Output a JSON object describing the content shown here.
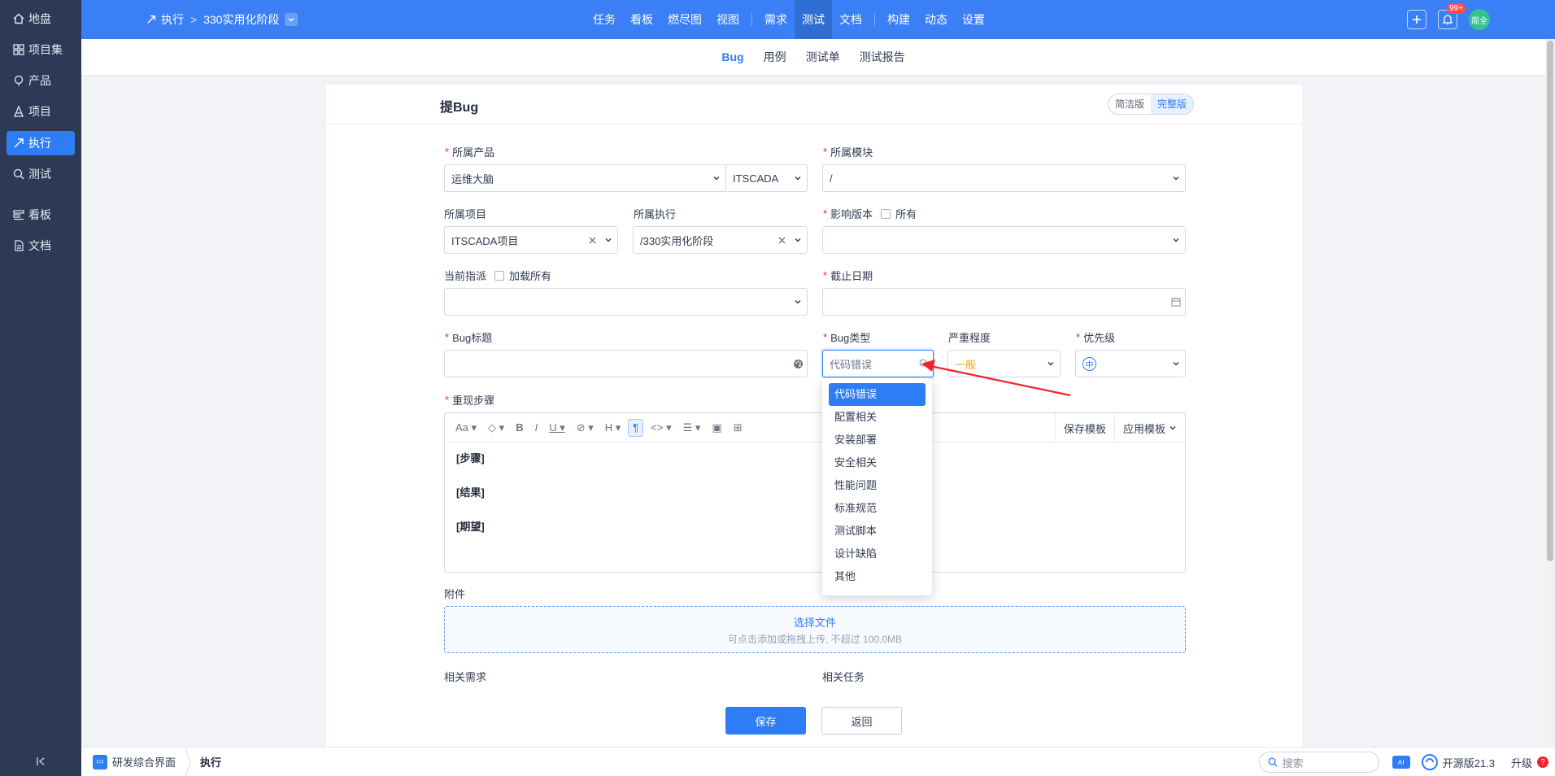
{
  "sidebar": {
    "items": [
      {
        "label": "地盘",
        "icon": "home-icon"
      },
      {
        "label": "项目集",
        "icon": "grid-icon"
      },
      {
        "label": "产品",
        "icon": "product-icon"
      },
      {
        "label": "项目",
        "icon": "project-icon"
      },
      {
        "label": "执行",
        "icon": "execute-icon",
        "active": true
      },
      {
        "label": "测试",
        "icon": "test-icon"
      },
      {
        "label": "看板",
        "icon": "kanban-icon"
      },
      {
        "label": "文档",
        "icon": "doc-icon"
      }
    ]
  },
  "header": {
    "breadcrumb_root": "执行",
    "breadcrumb_current": "330实用化阶段",
    "nav": [
      "任务",
      "看板",
      "燃尽图",
      "视图",
      "需求",
      "测试",
      "文档",
      "构建",
      "动态",
      "设置"
    ],
    "nav_active": "测试",
    "notification_badge": "99+",
    "avatar_text": "周全",
    "brand_color": "#3a7ff5"
  },
  "subnav": {
    "items": [
      "Bug",
      "用例",
      "测试单",
      "测试报告"
    ],
    "active": "Bug"
  },
  "form": {
    "title": "提Bug",
    "mode_simple": "简洁版",
    "mode_full": "完整版",
    "product_label": "所属产品",
    "product_value": "运维大脑",
    "branch_value": "ITSCADA",
    "module_label": "所属模块",
    "module_value": "/",
    "project_label": "所属项目",
    "project_value": "ITSCADA项目",
    "execution_label": "所属执行",
    "execution_value": "/330实用化阶段",
    "build_label": "影响版本",
    "build_all": "所有",
    "assign_label": "当前指派",
    "assign_load_all": "加载所有",
    "deadline_label": "截止日期",
    "title_label": "Bug标题",
    "type_label": "Bug类型",
    "type_search_value": "代码错误",
    "severity_label": "严重程度",
    "severity_value": "一般",
    "priority_label": "优先级",
    "priority_value": "中",
    "steps_label": "重现步骤",
    "steps_lines": [
      "[步骤]",
      "[结果]",
      "[期望]"
    ],
    "save_template": "保存模板",
    "apply_template": "应用模板",
    "attach_label": "附件",
    "attach_choose": "选择文件",
    "attach_hint": "可点击添加或拖拽上传, 不超过 100.0MB",
    "story_label": "相关需求",
    "task_label": "相关任务",
    "save_button": "保存",
    "back_button": "返回"
  },
  "bug_type_dropdown": {
    "options": [
      "代码错误",
      "配置相关",
      "安装部署",
      "安全相关",
      "性能问题",
      "标准规范",
      "测试脚本",
      "设计缺陷",
      "其他"
    ],
    "selected": "代码错误"
  },
  "footer": {
    "app_label": "研发综合界面",
    "current": "执行",
    "search_placeholder": "搜索",
    "version": "开源版21.3",
    "upgrade": "升级"
  }
}
